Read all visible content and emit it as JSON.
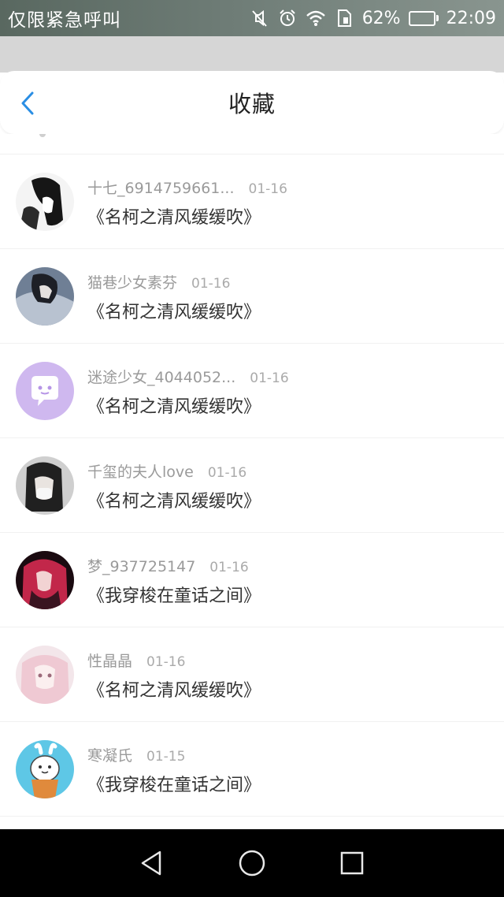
{
  "status_bar": {
    "carrier_text": "仅限紧急呼叫",
    "battery_text": "62%",
    "battery_level": 0.62,
    "time": "22:09",
    "icons": [
      "mute-icon",
      "alarm-icon",
      "wifi-icon",
      "sim-icon",
      "battery-icon"
    ]
  },
  "header": {
    "title": "收藏",
    "back_icon": "chevron-left-icon",
    "accent_color": "#2a8ee4"
  },
  "items": [
    {
      "user": "十七_6914759661...",
      "date": "01-16",
      "work": "《名柯之清风缓缓吹》"
    },
    {
      "user": "猫巷少女素芬",
      "date": "01-16",
      "work": "《名柯之清风缓缓吹》"
    },
    {
      "user": "迷途少女_4044052...",
      "date": "01-16",
      "work": "《名柯之清风缓缓吹》"
    },
    {
      "user": "千玺的夫人love",
      "date": "01-16",
      "work": "《名柯之清风缓缓吹》"
    },
    {
      "user": "梦_937725147",
      "date": "01-16",
      "work": "《我穿梭在童话之间》"
    },
    {
      "user": "性晶晶",
      "date": "01-16",
      "work": "《名柯之清风缓缓吹》"
    },
    {
      "user": "寒凝氏",
      "date": "01-15",
      "work": "《我穿梭在童话之间》"
    }
  ],
  "nav": {
    "back_icon": "triangle-back-icon",
    "home_icon": "circle-home-icon",
    "recents_icon": "square-recents-icon"
  }
}
